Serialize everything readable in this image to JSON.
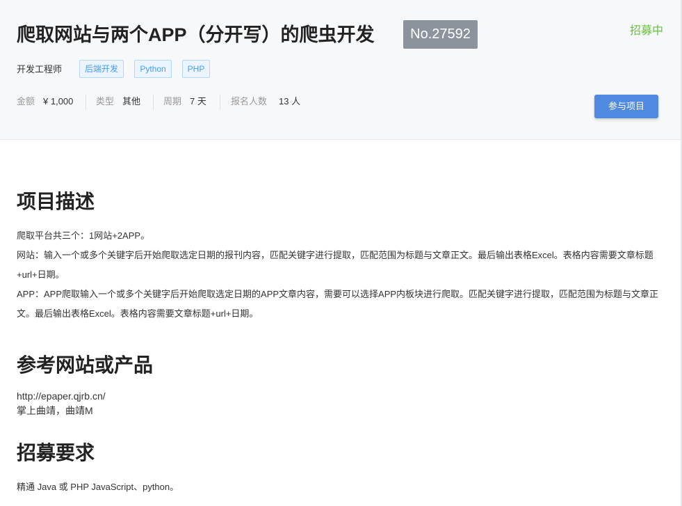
{
  "project": {
    "title": "爬取网站与两个APP（分开写）的爬虫开发",
    "number": "No.27592",
    "status": "招募中",
    "role": "开发工程师",
    "tags": [
      "后端开发",
      "Python",
      "PHP"
    ],
    "meta": {
      "amount_label": "金额",
      "amount_value": "¥ 1,000",
      "type_label": "类型",
      "type_value": "其他",
      "period_label": "周期",
      "period_value": "7 天",
      "applicants_label": "报名人数",
      "applicants_value": "13 人"
    },
    "join_label": "参与项目"
  },
  "description": {
    "heading": "项目描述",
    "paragraphs": [
      "爬取平台共三个：1网站+2APP。",
      "网站：输入一个或多个关键字后开始爬取选定日期的报刊内容，匹配关键字进行提取，匹配范围为标题与文章正文。最后输出表格Excel。表格内容需要文章标题+url+日期。",
      "APP：APP爬取输入一个或多个关键字后开始爬取选定日期的APP文章内容，需要可以选择APP内板块进行爬取。匹配关键字进行提取，匹配范围为标题与文章正文。最后输出表格Excel。表格内容需要文章标题+url+日期。"
    ]
  },
  "reference": {
    "heading": "参考网站或产品",
    "lines": [
      "http://epaper.qjrb.cn/",
      "掌上曲靖，曲靖M"
    ]
  },
  "requirements": {
    "heading": "招募要求",
    "text": "精通 Java 或 PHP JavaScript、python。"
  },
  "colors": {
    "status_green": "#67c23a",
    "tag_blue": "#409eff",
    "button_blue": "#4f8ae0",
    "number_badge": "#8c939d"
  }
}
